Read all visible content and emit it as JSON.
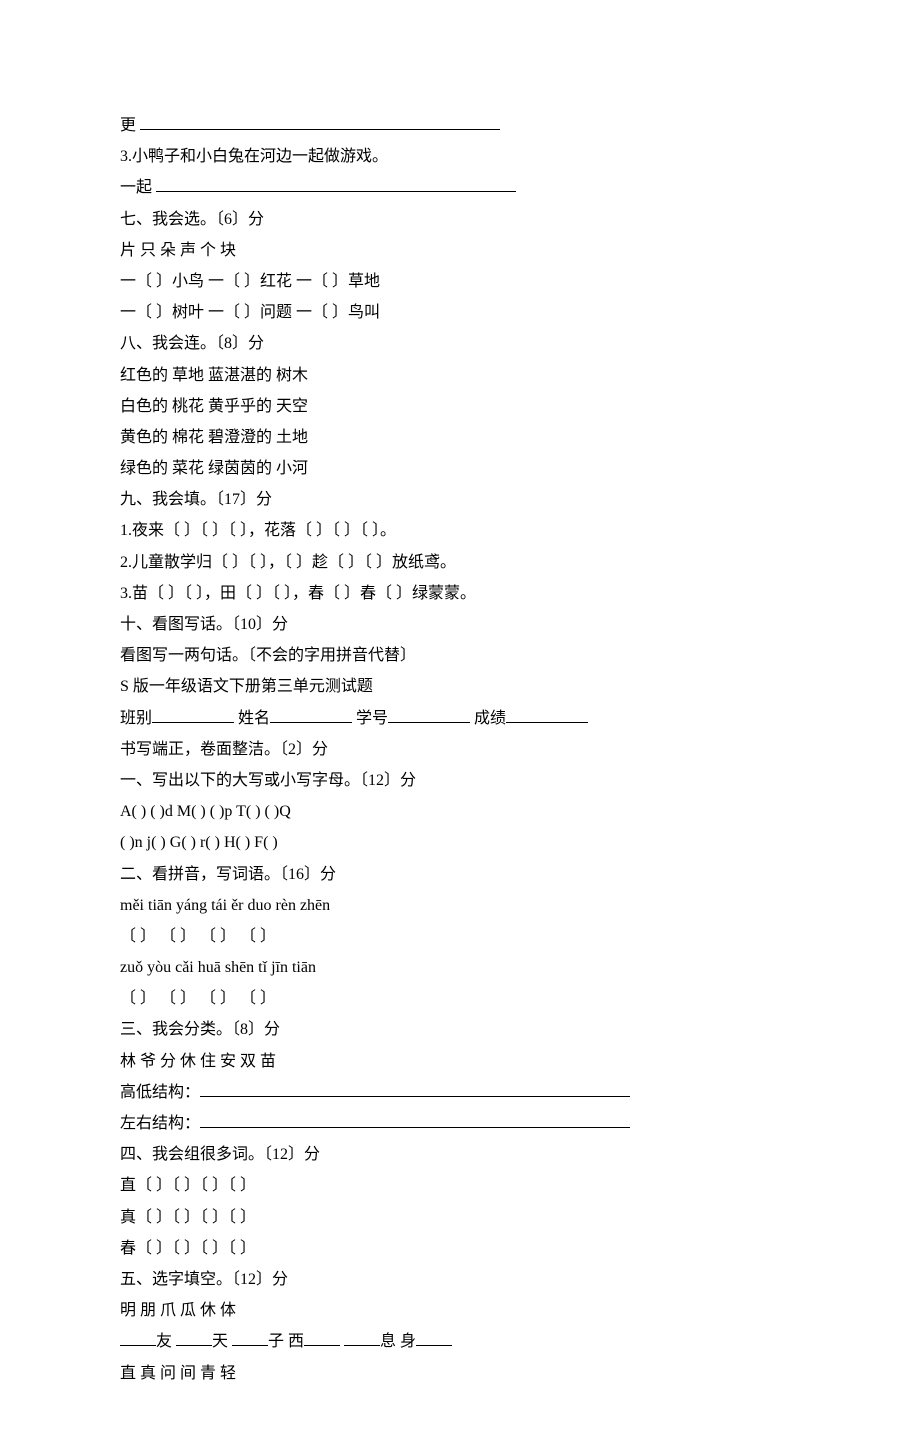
{
  "l1_pre": "更 ",
  "l2": "3.小鸭子和小白兔在河边一起做游戏。",
  "l3_pre": "一起 ",
  "s7_title": "七、我会选。〔6〕分",
  "s7_l1": "片 只 朵 声 个 块",
  "s7_l2": "一〔 〕小鸟  一〔 〕红花  一〔 〕草地",
  "s7_l3": "一〔 〕树叶  一〔 〕问题  一〔 〕鸟叫",
  "s8_title": "八、我会连。〔8〕分",
  "s8_l1": "红色的  草地   蓝湛湛的  树木",
  "s8_l2": "白色的  桃花   黄乎乎的  天空",
  "s8_l3": "黄色的  棉花   碧澄澄的  土地",
  "s8_l4": "绿色的  菜花   绿茵茵的  小河",
  "s9_title": "九、我会填。〔17〕分",
  "s9_l1": "1.夜来〔 〕〔 〕〔 〕，花落〔 〕〔 〕〔 〕。",
  "s9_l2": "2.儿童散学归〔 〕〔 〕，〔 〕趁〔 〕〔 〕放纸鸢。",
  "s9_l3": "3.苗〔 〕〔 〕，田〔 〕〔 〕，春〔 〕春〔 〕绿蒙蒙。",
  "s10_title": "十、看图写话。〔10〕分",
  "s10_l1": "看图写一两句话。〔不会的字用拼音代替〕",
  "header_title": "S 版一年级语文下册第三单元测试题",
  "header_class": "班别",
  "header_name": " 姓名",
  "header_id": "学号",
  "header_score": " 成绩",
  "header_note": "书写端正，卷面整洁。〔2〕分",
  "p1_title": "一、写出以下的大写或小写字母。〔12〕分",
  "p1_l1": "A( ) ( )d M( ) ( )p T( ) ( )Q",
  "p1_l2": "( )n j( ) G( ) r( ) H( ) F( )",
  "p2_title": "二、看拼音，写词语。〔16〕分",
  "p2_l1": "měi tiān yáng tái ěr duo rèn zhēn",
  "p2_l2": "〔 〕 〔 〕 〔 〕 〔 〕",
  "p2_l3": "zuǒ yòu cǎi huā shēn tǐ jīn tiān",
  "p2_l4": "〔 〕 〔 〕 〔 〕 〔 〕",
  "p3_title": "三、我会分类。〔8〕分",
  "p3_l1": "林 爷 分 休 住 安 双 苗",
  "p3_l2_pre": "高低结构：",
  "p3_l3_pre": "左右结构：",
  "p4_title": "四、我会组很多词。〔12〕分",
  "p4_l1": "直〔 〕〔 〕〔 〕〔 〕",
  "p4_l2": "真〔 〕〔 〕〔 〕〔 〕",
  "p4_l3": "春〔 〕〔 〕〔 〕〔 〕",
  "p5_title": "五、选字填空。〔12〕分",
  "p5_l1": "明 朋 爪 瓜 休 体",
  "p5_l2_a": "友 ",
  "p5_l2_b": "天 ",
  "p5_l2_c": "子 西",
  "p5_l2_d": " ",
  "p5_l2_e": "息 身",
  "p5_l3": "直 真 问 间 青 轻"
}
